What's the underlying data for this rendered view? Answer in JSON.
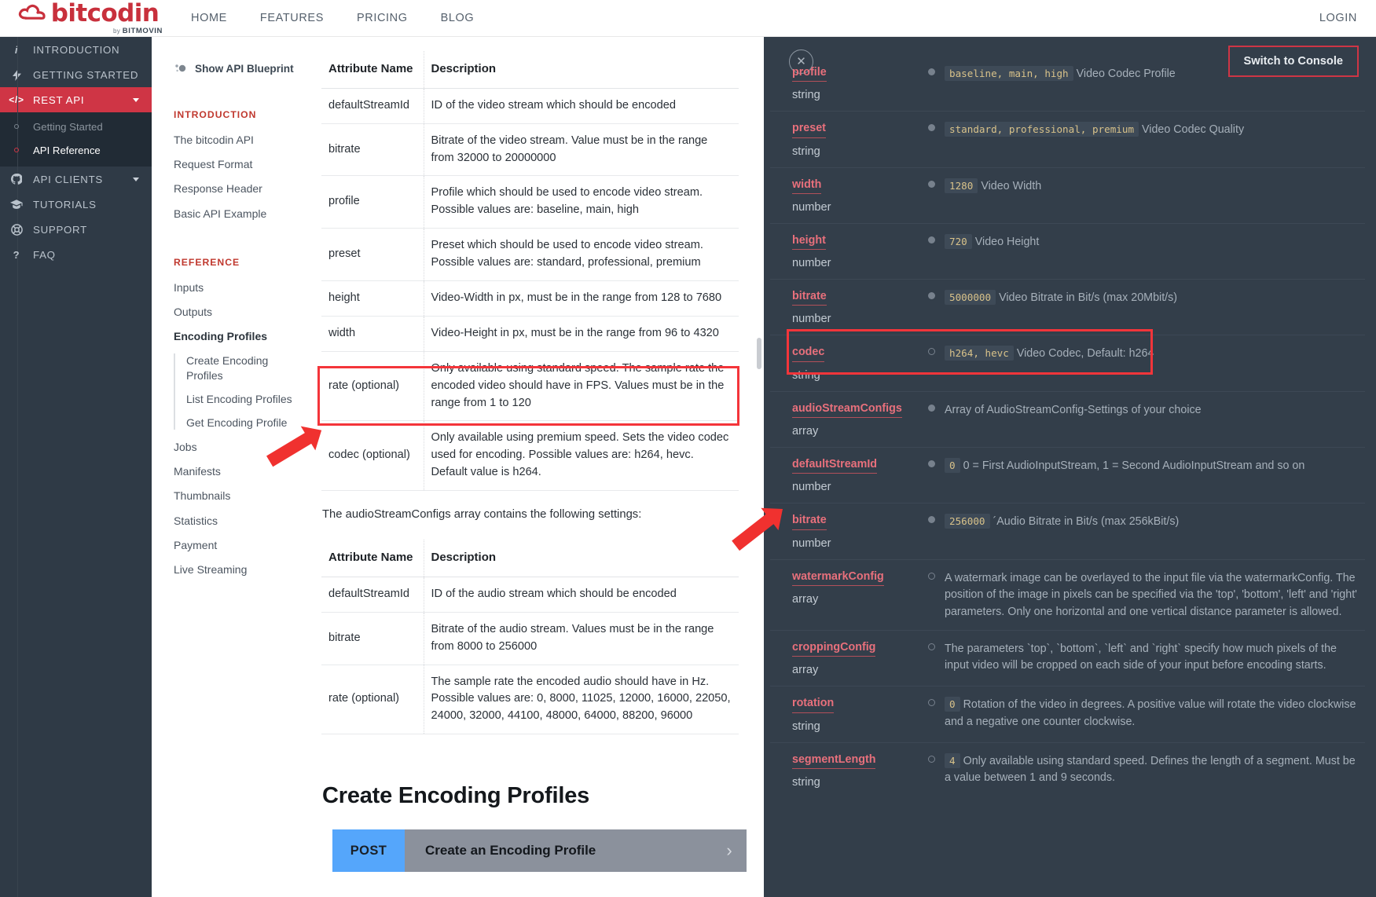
{
  "topbar": {
    "brand_name": "bitcodin",
    "brand_by": "by",
    "brand_company": "BITMOVIN",
    "nav": [
      {
        "label": "HOME"
      },
      {
        "label": "FEATURES"
      },
      {
        "label": "PRICING"
      },
      {
        "label": "BLOG"
      }
    ],
    "login_label": "LOGIN"
  },
  "sidebar": {
    "items": [
      {
        "label": "INTRODUCTION",
        "icon": "info-icon",
        "glyph": "i",
        "active": false,
        "caret": false
      },
      {
        "label": "GETTING STARTED",
        "icon": "bolt-icon",
        "glyph": "⚡",
        "active": false,
        "caret": false
      },
      {
        "label": "REST API",
        "icon": "code-icon",
        "glyph": "</>",
        "active": true,
        "caret": true
      },
      {
        "label": "API CLIENTS",
        "icon": "github-icon",
        "glyph": "⚇",
        "active": false,
        "caret": true
      },
      {
        "label": "TUTORIALS",
        "icon": "graduation-cap-icon",
        "glyph": "🎓",
        "active": false,
        "caret": false
      },
      {
        "label": "SUPPORT",
        "icon": "lifebuoy-icon",
        "glyph": "❁",
        "active": false,
        "caret": false
      },
      {
        "label": "FAQ",
        "icon": "question-mark-icon",
        "glyph": "?",
        "active": false,
        "caret": false
      }
    ],
    "subitems": [
      {
        "label": "Getting Started",
        "selected": false
      },
      {
        "label": "API Reference",
        "selected": true
      }
    ]
  },
  "toc": {
    "blueprint_label": "Show API Blueprint",
    "blueprint_icon": "blueprint-dots-icon",
    "introduction_heading": "INTRODUCTION",
    "introduction_links": [
      {
        "label": "The bitcodin API"
      },
      {
        "label": "Request Format"
      },
      {
        "label": "Response Header"
      },
      {
        "label": "Basic API Example"
      }
    ],
    "reference_heading": "REFERENCE",
    "reference_links": [
      {
        "label": "Inputs"
      },
      {
        "label": "Outputs"
      }
    ],
    "encoding_profiles_label": "Encoding Profiles",
    "encoding_profiles_children": [
      {
        "label": "Create Encoding Profiles"
      },
      {
        "label": "List Encoding Profiles"
      },
      {
        "label": "Get Encoding Profile"
      }
    ],
    "tail_links": [
      {
        "label": "Jobs"
      },
      {
        "label": "Manifests"
      },
      {
        "label": "Thumbnails"
      },
      {
        "label": "Statistics"
      },
      {
        "label": "Payment"
      },
      {
        "label": "Live Streaming"
      }
    ]
  },
  "main": {
    "video_table": {
      "headers": {
        "attribute": "Attribute Name",
        "description": "Description"
      },
      "rows": [
        {
          "attribute": "defaultStreamId",
          "description": "ID of the video stream which should be encoded"
        },
        {
          "attribute": "bitrate",
          "description": "Bitrate of the video stream. Value must be in the range from 32000 to 20000000"
        },
        {
          "attribute": "profile",
          "description": "Profile which should be used to encode video stream. Possible values are: baseline, main, high"
        },
        {
          "attribute": "preset",
          "description": "Preset which should be used to encode video stream. Possible values are: standard, professional, premium"
        },
        {
          "attribute": "height",
          "description": "Video-Width in px, must be in the range from 128 to 7680"
        },
        {
          "attribute": "width",
          "description": "Video-Height in px, must be in the range from 96 to 4320"
        },
        {
          "attribute": "rate (optional)",
          "description": "Only available using standard speed. The sample rate the encoded video should have in FPS. Values must be in the range from 1 to 120"
        },
        {
          "attribute": "codec (optional)",
          "description": "Only available using premium speed. Sets the video codec used for encoding. Possible values are: h264, hevc. Default value is h264."
        }
      ]
    },
    "paragraph": "The audioStreamConfigs array contains the following settings:",
    "audio_table": {
      "headers": {
        "attribute": "Attribute Name",
        "description": "Description"
      },
      "rows": [
        {
          "attribute": "defaultStreamId",
          "description": "ID of the audio stream which should be encoded"
        },
        {
          "attribute": "bitrate",
          "description": "Bitrate of the audio stream. Values must be in the range from 8000 to 256000"
        },
        {
          "attribute": "rate (optional)",
          "description": "The sample rate the encoded audio should have in Hz. Possible values are: 0, 8000, 11025, 12000, 16000, 22050, 24000, 32000, 44100, 48000, 64000, 88200, 96000"
        }
      ]
    },
    "section_title": "Create Encoding Profiles",
    "endpoint": {
      "method": "POST",
      "title": "Create an Encoding Profile",
      "chevron": "chevron-right-icon"
    }
  },
  "right_panel": {
    "close_icon": "close-icon",
    "switch_label": "Switch to Console",
    "params": [
      {
        "name": "profile",
        "type": "string",
        "required": true,
        "code": "baseline, main, high",
        "desc": "Video Codec Profile"
      },
      {
        "name": "preset",
        "type": "string",
        "required": true,
        "code": "standard, professional, premium",
        "desc": "Video Codec Quality"
      },
      {
        "name": "width",
        "type": "number",
        "required": true,
        "code": "1280",
        "desc": "Video Width"
      },
      {
        "name": "height",
        "type": "number",
        "required": true,
        "code": "720",
        "desc": "Video Height"
      },
      {
        "name": "bitrate",
        "type": "number",
        "required": true,
        "code": "5000000",
        "desc": "Video Bitrate in Bit/s (max 20Mbit/s)"
      },
      {
        "name": "codec",
        "type": "string",
        "required": false,
        "code": "h264, hevc",
        "desc": "Video Codec, Default: h264",
        "highlighted": true
      },
      {
        "name": "audioStreamConfigs",
        "type": "array",
        "required": true,
        "code": "",
        "desc": "Array of AudioStreamConfig-Settings of your choice"
      },
      {
        "name": "defaultStreamId",
        "type": "number",
        "required": true,
        "code": "0",
        "desc": "0 = First AudioInputStream, 1 = Second AudioInputStream and so on"
      },
      {
        "name": "bitrate",
        "type": "number",
        "required": true,
        "code": "256000",
        "desc": "´Audio Bitrate in Bit/s (max 256kBit/s)"
      },
      {
        "name": "watermarkConfig",
        "type": "array",
        "required": false,
        "code": "",
        "desc": "A watermark image can be overlayed to the input file via the watermarkConfig. The position of the image in pixels can be specified via the 'top', 'bottom', 'left' and 'right' parameters. Only one horizontal and one vertical distance parameter is allowed."
      },
      {
        "name": "croppingConfig",
        "type": "array",
        "required": false,
        "code": "",
        "desc": "The parameters `top`, `bottom`, `left` and `right` specify how much pixels of the input video will be cropped on each side of your input before encoding starts."
      },
      {
        "name": "rotation",
        "type": "string",
        "required": false,
        "code": "0",
        "desc": "Rotation of the video in degrees. A positive value will rotate the video clockwise and a negative one counter clockwise."
      },
      {
        "name": "segmentLength",
        "type": "string",
        "required": false,
        "code": "4",
        "desc": "Only available using standard speed. Defines the length of a segment. Must be a value between 1 and 9 seconds."
      }
    ]
  },
  "annotations": {
    "highlight_color": "#f4353a",
    "arrow_color": "#f0312f",
    "accent_red": "#cf3545",
    "accent_blue": "#55a6fb"
  }
}
